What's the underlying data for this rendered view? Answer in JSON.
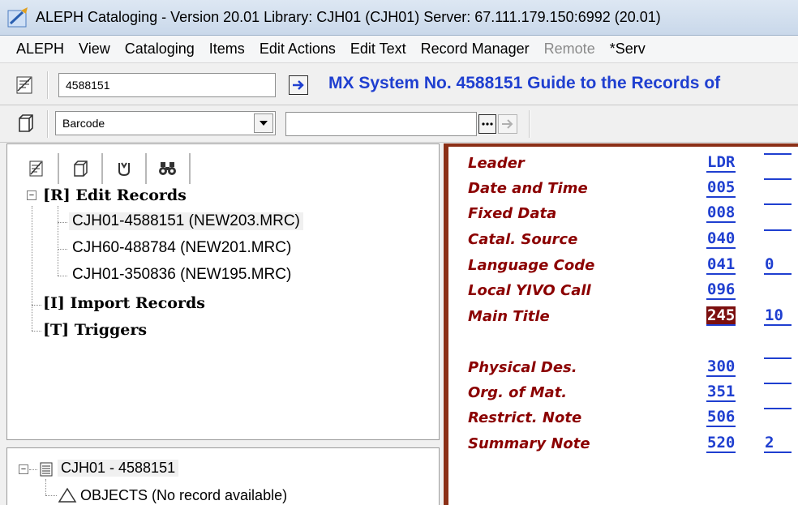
{
  "window": {
    "title": "ALEPH Cataloging - Version 20.01  Library:  CJH01 (CJH01)  Server:  67.111.179.150:6992 (20.01)"
  },
  "menu": [
    "ALEPH",
    "View",
    "Cataloging",
    "Items",
    "Edit Actions",
    "Edit Text",
    "Record Manager",
    "Remote",
    "*Serv"
  ],
  "menu_disabled_index": 7,
  "toolbar": {
    "record_input_value": "4588151",
    "heading": "MX System No. 4588151 Guide to the Records of",
    "search_type": "Barcode",
    "search_input_value": ""
  },
  "tree": {
    "edit_records": "[R] Edit Records",
    "records": [
      "CJH01-4588151 (NEW203.MRC)",
      "CJH60-488784 (NEW201.MRC)",
      "CJH01-350836 (NEW195.MRC)"
    ],
    "import_records": "[I] Import Records",
    "triggers": "[T] Triggers"
  },
  "bottom_tree": {
    "root": "CJH01 - 4588151",
    "child": "OBJECTS (No record available)"
  },
  "fields": [
    {
      "label": "Leader",
      "tag": "LDR",
      "ind": ""
    },
    {
      "label": "Date and Time",
      "tag": "005",
      "ind": ""
    },
    {
      "label": "Fixed Data",
      "tag": "008",
      "ind": ""
    },
    {
      "label": "Catal. Source",
      "tag": "040",
      "ind": ""
    },
    {
      "label": "Language Code",
      "tag": "041",
      "ind": "0"
    },
    {
      "label": "Local YIVO Call",
      "tag": "096",
      "ind": ""
    },
    {
      "label": "Main Title",
      "tag": "245",
      "ind": "10"
    },
    {
      "label": "Physical Des.",
      "tag": "300",
      "ind": ""
    },
    {
      "label": "Org. of Mat.",
      "tag": "351",
      "ind": ""
    },
    {
      "label": "Restrict. Note",
      "tag": "506",
      "ind": ""
    },
    {
      "label": "Summary Note",
      "tag": "520",
      "ind": "2"
    }
  ],
  "colors": {
    "field_label": "#8b0000",
    "tag": "#1f3fd0",
    "active_tag_bg": "#7b0f0f",
    "heading": "#1f3fd0"
  }
}
